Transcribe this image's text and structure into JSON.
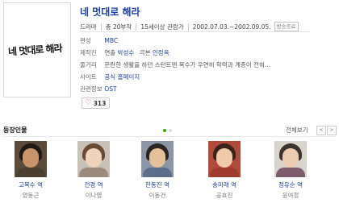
{
  "poster": {
    "text": "네 멋대로 해라"
  },
  "title": "네 멋대로 해라",
  "meta": {
    "genre": "드라마",
    "episodes": "총 20부작",
    "rating": "15세이상 관람가",
    "dates": "2002.07.03.~2002.09.05.",
    "status": "방송종료"
  },
  "info": {
    "network": {
      "label": "편성",
      "value": "MBC"
    },
    "staff": {
      "label": "제작진",
      "director_role": "연출",
      "director": "박성수",
      "writer_role": "극본",
      "writer": "인정옥"
    },
    "synopsis": {
      "label": "줄거리",
      "text": "문란한 생활을 하던 스턴트맨 복수가 우연히 학력과 계층이 전혀..."
    },
    "site": {
      "label": "사이트",
      "value": "공식 홈페이지"
    },
    "related": {
      "label": "관련정보",
      "value": "OST"
    }
  },
  "like": {
    "count": "313"
  },
  "cast_section": {
    "title": "등장인물",
    "see_all": "전체보기",
    "prev": "<",
    "next": ">"
  },
  "cast": [
    {
      "role": "고복수 역",
      "actor": "양동근"
    },
    {
      "role": "전경 역",
      "actor": "이나영"
    },
    {
      "role": "한동진 역",
      "actor": "이동건"
    },
    {
      "role": "송미래 역",
      "actor": "공효진"
    },
    {
      "role": "정유순 역",
      "actor": "윤여정"
    }
  ],
  "colors": {
    "link": "#1a3fa8",
    "heart": "#e0304a",
    "active_dot": "#2db400"
  }
}
